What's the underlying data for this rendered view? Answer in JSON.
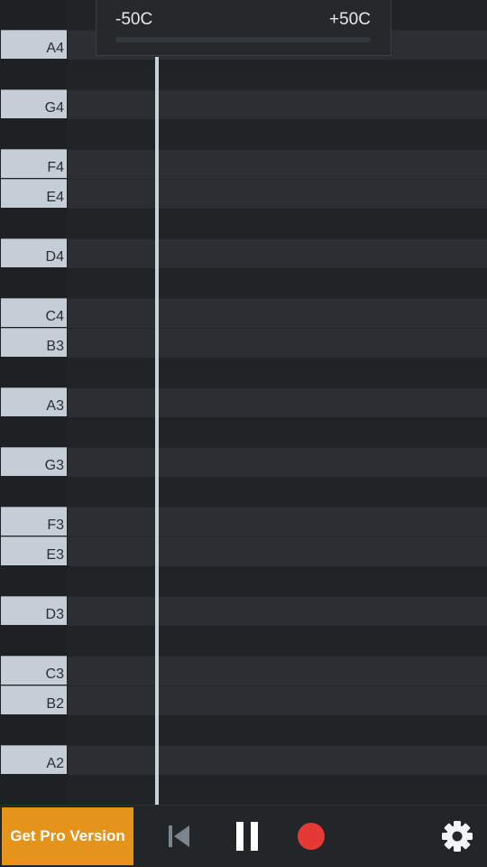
{
  "cents_meter": {
    "min_label": "-50C",
    "max_label": "+50C"
  },
  "piano_keys": [
    {
      "note": "A4",
      "label": "A4"
    },
    {
      "note": "G4",
      "label": "G4"
    },
    {
      "note": "F4",
      "label": "F4"
    },
    {
      "note": "E4",
      "label": "E4"
    },
    {
      "note": "D4",
      "label": "D4"
    },
    {
      "note": "C4",
      "label": "C4"
    },
    {
      "note": "B3",
      "label": "B3"
    },
    {
      "note": "A3",
      "label": "A3"
    },
    {
      "note": "G3",
      "label": "G3"
    },
    {
      "note": "F3",
      "label": "F3"
    },
    {
      "note": "E3",
      "label": "E3"
    },
    {
      "note": "D3",
      "label": "D3"
    },
    {
      "note": "C3",
      "label": "C3"
    },
    {
      "note": "B2",
      "label": "B2"
    },
    {
      "note": "A2",
      "label": "A2"
    }
  ],
  "toolbar": {
    "pro_label": "Get Pro Version",
    "rewind_icon": "skip-to-start-icon",
    "pause_icon": "pause-icon",
    "record_icon": "record-icon",
    "settings_icon": "gear-icon"
  },
  "colors": {
    "accent": "#e4931b",
    "record": "#e53935",
    "key_white": "#c5ced6",
    "playhead": "#c8d0d8"
  }
}
